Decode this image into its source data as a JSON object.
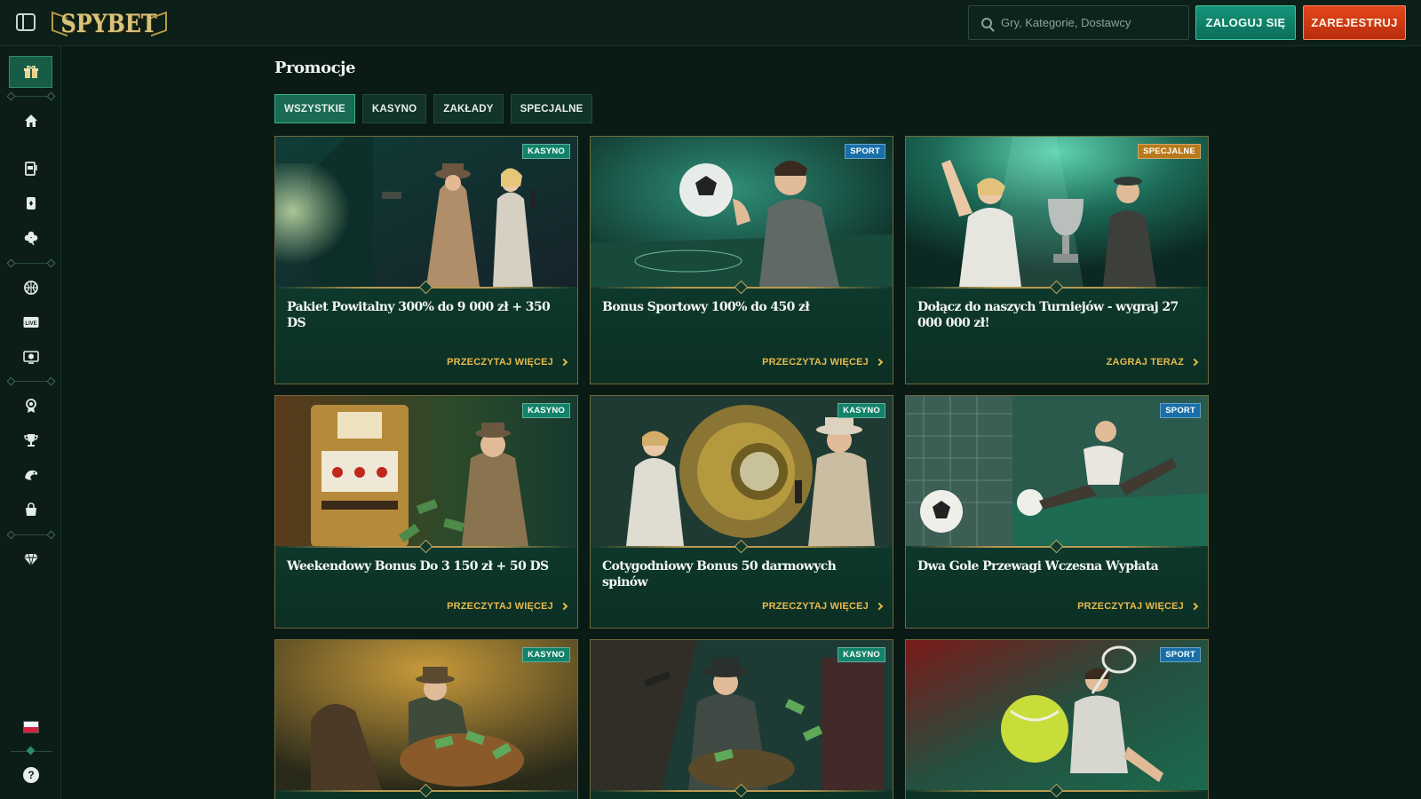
{
  "header": {
    "logo_text": "SPYBET",
    "search_placeholder": "Gry, Kategorie, Dostawcy",
    "login_label": "ZALOGUJ SIĘ",
    "register_label": "ZAREJESTRUJ"
  },
  "sidebar": {
    "items": [
      {
        "icon": "gift-icon",
        "active": true
      },
      {
        "icon": "home-icon"
      },
      {
        "icon": "slot-machine-icon"
      },
      {
        "icon": "playing-card-icon"
      },
      {
        "icon": "clover-icon"
      },
      {
        "icon": "basketball-icon"
      },
      {
        "icon": "live-icon",
        "label": "LIVE"
      },
      {
        "icon": "virtual-sports-icon"
      },
      {
        "icon": "medal-icon"
      },
      {
        "icon": "trophy-icon"
      },
      {
        "icon": "chameleon-icon"
      },
      {
        "icon": "shopping-bag-icon"
      },
      {
        "icon": "diamond-icon"
      }
    ],
    "language_flag": "flag-poland-icon",
    "help_label": "?"
  },
  "main": {
    "title": "Promocje",
    "tabs": [
      {
        "label": "WSZYSTKIE",
        "active": true
      },
      {
        "label": "KASYNO"
      },
      {
        "label": "ZAKŁADY"
      },
      {
        "label": "SPECJALNE"
      }
    ],
    "cards": [
      {
        "badge": "KASYNO",
        "badge_type": "kasyno",
        "title": "Pakiet Powitalny 300% do 9 000 zł + 350 DS",
        "cta": "PRZECZYTAJ WIĘCEJ",
        "scene": "detectives-flashlight"
      },
      {
        "badge": "SPORT",
        "badge_type": "sport",
        "title": "Bonus Sportowy 100% do 450 zł",
        "cta": "PRZECZYTAJ WIĘCEJ",
        "scene": "soccer-player-ball"
      },
      {
        "badge": "SPECJALNE",
        "badge_type": "specjalne",
        "title": "Dołącz do naszych Turniejów - wygraj 27 000 000 zł!",
        "cta": "ZAGRAJ TERAZ",
        "scene": "trophy-celebration"
      },
      {
        "badge": "KASYNO",
        "badge_type": "kasyno",
        "title": "Weekendowy Bonus Do 3 150 zł + 50 DS",
        "cta": "PRZECZYTAJ WIĘCEJ",
        "scene": "slot-machine-money"
      },
      {
        "badge": "KASYNO",
        "badge_type": "kasyno",
        "title": "Cotygodniowy Bonus 50 darmowych spinów",
        "cta": "PRZECZYTAJ WIĘCEJ",
        "scene": "vault-heist"
      },
      {
        "badge": "SPORT",
        "badge_type": "sport",
        "title": "Dwa Gole Przewagi Wczesna Wypłata",
        "cta": "PRZECZYTAJ WIĘCEJ",
        "scene": "soccer-kick"
      },
      {
        "badge": "KASYNO",
        "badge_type": "kasyno",
        "title": "",
        "cta": "",
        "scene": "money-bag-relax"
      },
      {
        "badge": "KASYNO",
        "badge_type": "kasyno",
        "title": "",
        "cta": "",
        "scene": "gangster-cash"
      },
      {
        "badge": "SPORT",
        "badge_type": "sport",
        "title": "",
        "cta": "",
        "scene": "tennis-player"
      }
    ]
  },
  "colors": {
    "background": "#0a1a14",
    "card_green": "#12473a",
    "accent_gold": "#e6b94d",
    "login_green": "#15957a",
    "register_orange": "#e3471a"
  }
}
